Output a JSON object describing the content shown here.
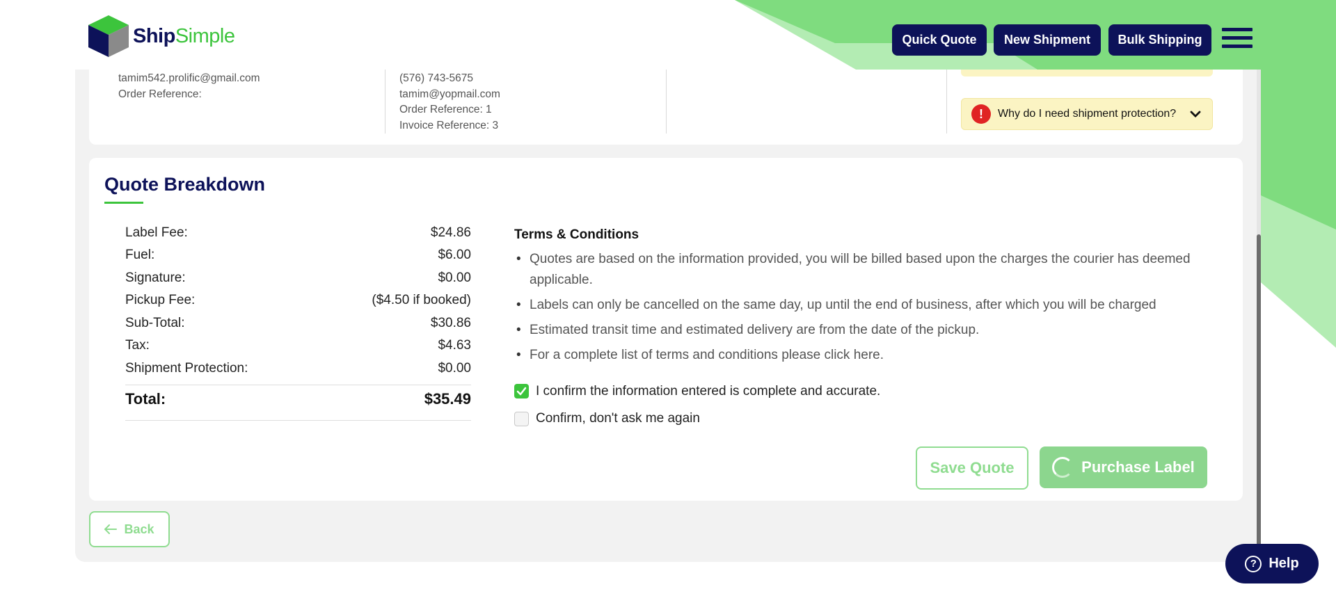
{
  "header": {
    "logo_ship": "Ship",
    "logo_simple": "Simple",
    "nav": [
      "Quick Quote",
      "New Shipment",
      "Bulk Shipping"
    ]
  },
  "sender": {
    "email": "tamim542.prolific@gmail.com",
    "order_ref": "Order Reference:"
  },
  "recipient": {
    "phone": "(576) 743-5675",
    "email": "tamim@yopmail.com",
    "order_ref": "Order Reference: 1",
    "invoice_ref": "Invoice Reference: 3"
  },
  "protection_prompt": "Why do I need shipment protection?",
  "quote": {
    "title": "Quote Breakdown",
    "rows": [
      {
        "label": "Label Fee:",
        "value": "$24.86"
      },
      {
        "label": "Fuel:",
        "value": "$6.00"
      },
      {
        "label": "Signature:",
        "value": "$0.00"
      },
      {
        "label": "Pickup Fee:",
        "value": "($4.50 if booked)"
      },
      {
        "label": "Sub-Total:",
        "value": "$30.86"
      },
      {
        "label": "Tax:",
        "value": "$4.63"
      },
      {
        "label": "Shipment Protection:",
        "value": "$0.00"
      }
    ],
    "total_label": "Total:",
    "total_value": "$35.49"
  },
  "terms": {
    "title": "Terms & Conditions",
    "items": [
      "Quotes are based on the information provided, you will be billed based upon the charges the courier has deemed applicable.",
      "Labels can only be cancelled on the same day, up until the end of business, after which you will be charged",
      "Estimated transit time and estimated delivery are from the date of the pickup.",
      "For a complete list of terms and conditions please click here."
    ],
    "confirm_label": "I confirm the information entered is complete and accurate.",
    "confirm_checked": true,
    "dont_ask_label": "Confirm, don't ask me again",
    "dont_ask_checked": false
  },
  "actions": {
    "save": "Save Quote",
    "purchase": "Purchase Label",
    "back": "Back",
    "help": "Help"
  },
  "colors": {
    "navy": "#0d1259",
    "green": "#3cc43c",
    "light_green": "#8cd68e",
    "yellow": "#fbf4c3"
  }
}
